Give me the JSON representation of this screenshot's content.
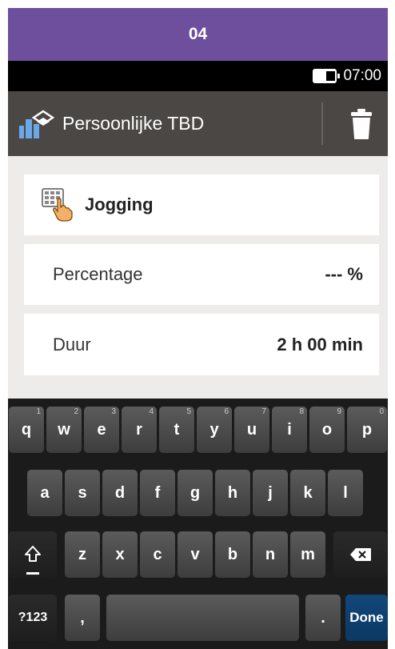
{
  "step_banner": {
    "label": "04"
  },
  "status_bar": {
    "time": "07:00",
    "battery_icon": "battery-icon"
  },
  "title_bar": {
    "title": "Persoonlijke TBD",
    "app_icon": "personal-tbd-icon",
    "delete_icon": "trash-icon"
  },
  "activity": {
    "label": "Jogging",
    "icon": "keypad-hand-icon"
  },
  "percentage": {
    "label": "Percentage",
    "value": "--- %"
  },
  "duration": {
    "label": "Duur",
    "value": "2 h 00 min"
  },
  "keyboard": {
    "row1": [
      {
        "label": "q",
        "hint": "1"
      },
      {
        "label": "w",
        "hint": "2"
      },
      {
        "label": "e",
        "hint": "3"
      },
      {
        "label": "r",
        "hint": "4"
      },
      {
        "label": "t",
        "hint": "5"
      },
      {
        "label": "y",
        "hint": "6"
      },
      {
        "label": "u",
        "hint": "7"
      },
      {
        "label": "i",
        "hint": "8"
      },
      {
        "label": "o",
        "hint": "9"
      },
      {
        "label": "p",
        "hint": "0"
      }
    ],
    "row2": [
      "a",
      "s",
      "d",
      "f",
      "g",
      "h",
      "j",
      "k",
      "l"
    ],
    "row3": [
      "z",
      "x",
      "c",
      "v",
      "b",
      "n",
      "m"
    ],
    "shift_icon": "shift-arrow-icon",
    "backspace_icon": "backspace-icon",
    "symbols_label": "?123",
    "comma_label": ",",
    "period_label": ".",
    "done_label": "Done"
  },
  "colors": {
    "banner": "#6e4f9e",
    "title_bar": "#4b4745",
    "done_key": "#12477a"
  }
}
